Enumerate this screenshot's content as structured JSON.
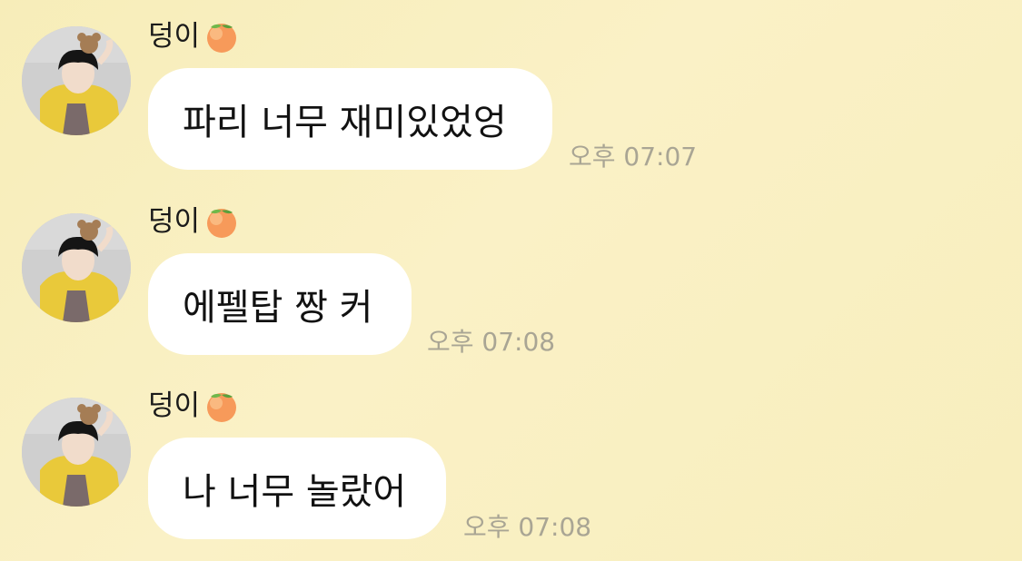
{
  "messages": [
    {
      "sender": "덩이",
      "text": "파리 너무 재미있었엉",
      "time": "오후 07:07"
    },
    {
      "sender": "덩이",
      "text": "에펠탑 짱 커",
      "time": "오후 07:08"
    },
    {
      "sender": "덩이",
      "text": "나 너무 놀랐어",
      "time": "오후 07:08"
    }
  ],
  "colors": {
    "background": "#f8eebd",
    "bubble": "#ffffff",
    "time": "#a9a594"
  },
  "icons": {
    "sender_emoji": "peach-icon"
  }
}
